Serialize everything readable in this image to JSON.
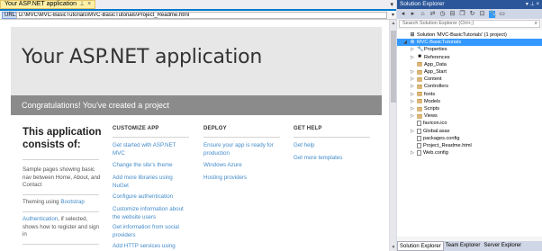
{
  "doc": {
    "tab_title": "Your ASP.NET application",
    "pin_glyph": "⊥",
    "close_glyph": "×",
    "url_label": "URL:",
    "url": "D:\\MVC\\MVC-BasicTutorials\\MVC-BasicTutorials\\Project_Readme.html"
  },
  "page": {
    "heading": "Your ASP.NET application",
    "banner": "Congratulations! You've created a project",
    "consists": "This application consists of:",
    "left_items": [
      "Sample pages showing basic nav between Home, About, and Contact",
      "Theming using ",
      "Bootstrap",
      "Authentication",
      ", if selected, shows how to register and sign in"
    ],
    "columns": [
      {
        "heading": "CUSTOMIZE APP",
        "links": [
          "Get started with ASP.NET MVC",
          "Change the site's theme",
          "Add more libraries using NuGet",
          "Configure authentication",
          "Customize information about the website users",
          "Get information from social providers",
          "Add HTTP services using"
        ]
      },
      {
        "heading": "DEPLOY",
        "links": [
          "Ensure your app is ready for production",
          "Windows Azure",
          "Hosting providers"
        ]
      },
      {
        "heading": "GET HELP",
        "links": [
          "Get help",
          "Get more templates"
        ]
      }
    ]
  },
  "explorer": {
    "title": "Solution Explorer",
    "title_controls": "▾ ⊥ ×",
    "search_placeholder": "Search Solution Explorer (Ctrl+;)",
    "nodes": [
      {
        "label": "Solution 'MVC-BasicTutorials' (1 project)",
        "expander": "",
        "icon": "solution-icon",
        "glyph": "⊞"
      },
      {
        "label": "MVC-BasicTutorials",
        "expander": "◢",
        "icon": "project-icon",
        "glyph": "⊕",
        "selected": true
      },
      {
        "label": "Properties",
        "expander": "▷",
        "icon": "wrench-icon",
        "glyph": "🔧"
      },
      {
        "label": "References",
        "expander": "▷",
        "icon": "references-icon",
        "glyph": "■"
      },
      {
        "label": "App_Data",
        "expander": "",
        "icon": "folder-icon"
      },
      {
        "label": "App_Start",
        "expander": "▷",
        "icon": "folder-icon"
      },
      {
        "label": "Content",
        "expander": "▷",
        "icon": "folder-icon"
      },
      {
        "label": "Controllers",
        "expander": "▷",
        "icon": "folder-icon"
      },
      {
        "label": "fonts",
        "expander": "▷",
        "icon": "folder-icon"
      },
      {
        "label": "Models",
        "expander": "▷",
        "icon": "folder-icon"
      },
      {
        "label": "Scripts",
        "expander": "▷",
        "icon": "folder-icon"
      },
      {
        "label": "Views",
        "expander": "▷",
        "icon": "folder-icon"
      },
      {
        "label": "favicon.ico",
        "expander": "",
        "icon": "file-icon"
      },
      {
        "label": "Global.asax",
        "expander": "▷",
        "icon": "file-icon"
      },
      {
        "label": "packages.config",
        "expander": "",
        "icon": "file-icon"
      },
      {
        "label": "Project_Readme.html",
        "expander": "",
        "icon": "file-icon"
      },
      {
        "label": "Web.config",
        "expander": "▷",
        "icon": "file-icon"
      }
    ],
    "tabs": [
      "Solution Explorer",
      "Team Explorer",
      "Server Explorer"
    ]
  },
  "colors": {
    "accent": "#007acc",
    "link": "#428bca",
    "selected": "#3399ff",
    "tab_active": "#fff1a5"
  }
}
